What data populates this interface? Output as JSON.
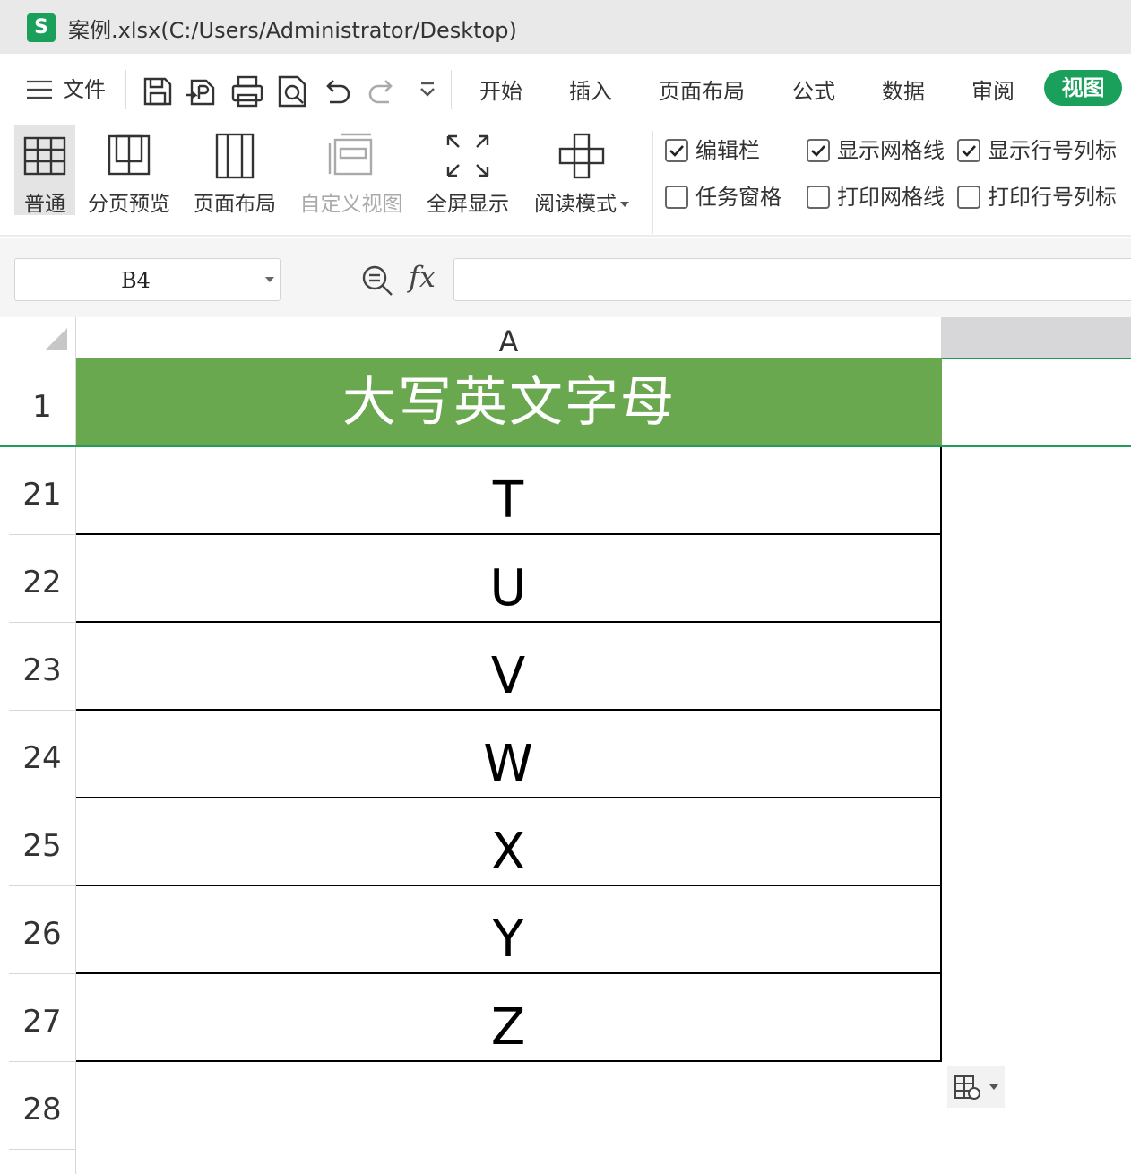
{
  "window": {
    "title": "案例.xlsx(C:/Users/Administrator/Desktop)",
    "logo_letter": "S",
    "brand_color": "#1aa05b"
  },
  "menu": {
    "file_label": "文件",
    "quick_icons": [
      "save-icon",
      "export-pdf-icon",
      "print-icon",
      "print-preview-icon",
      "undo-icon",
      "redo-icon",
      "more-dropdown-icon"
    ],
    "tabs": [
      "开始",
      "插入",
      "页面布局",
      "公式",
      "数据",
      "审阅"
    ],
    "active_tab": "视图"
  },
  "ribbon": {
    "buttons": [
      {
        "label": "普通",
        "icon": "normal-view-icon",
        "selected": true
      },
      {
        "label": "分页预览",
        "icon": "page-break-preview-icon"
      },
      {
        "label": "页面布局",
        "icon": "page-layout-icon"
      },
      {
        "label": "自定义视图",
        "icon": "custom-view-icon",
        "disabled": true
      },
      {
        "label": "全屏显示",
        "icon": "fullscreen-icon"
      },
      {
        "label": "阅读模式",
        "icon": "reading-mode-icon",
        "has_dropdown": true
      }
    ],
    "checkboxes": [
      {
        "label": "编辑栏",
        "checked": true
      },
      {
        "label": "显示网格线",
        "checked": true
      },
      {
        "label": "显示行号列标",
        "checked": true
      },
      {
        "label": "任务窗格",
        "checked": false
      },
      {
        "label": "打印网格线",
        "checked": false
      },
      {
        "label": "打印行号列标",
        "checked": false
      }
    ]
  },
  "formula_bar": {
    "name_box": "B4",
    "fx_label": "fx",
    "formula": ""
  },
  "sheet": {
    "column_header": "A",
    "header_row": {
      "row_number": "1",
      "text": "大写英文字母",
      "fill": "#6aa84f"
    },
    "rows": [
      {
        "row_number": "21",
        "value": "T"
      },
      {
        "row_number": "22",
        "value": "U"
      },
      {
        "row_number": "23",
        "value": "V"
      },
      {
        "row_number": "24",
        "value": "W"
      },
      {
        "row_number": "25",
        "value": "X"
      },
      {
        "row_number": "26",
        "value": "Y"
      },
      {
        "row_number": "27",
        "value": "Z"
      }
    ],
    "empty_row_number": "28"
  }
}
